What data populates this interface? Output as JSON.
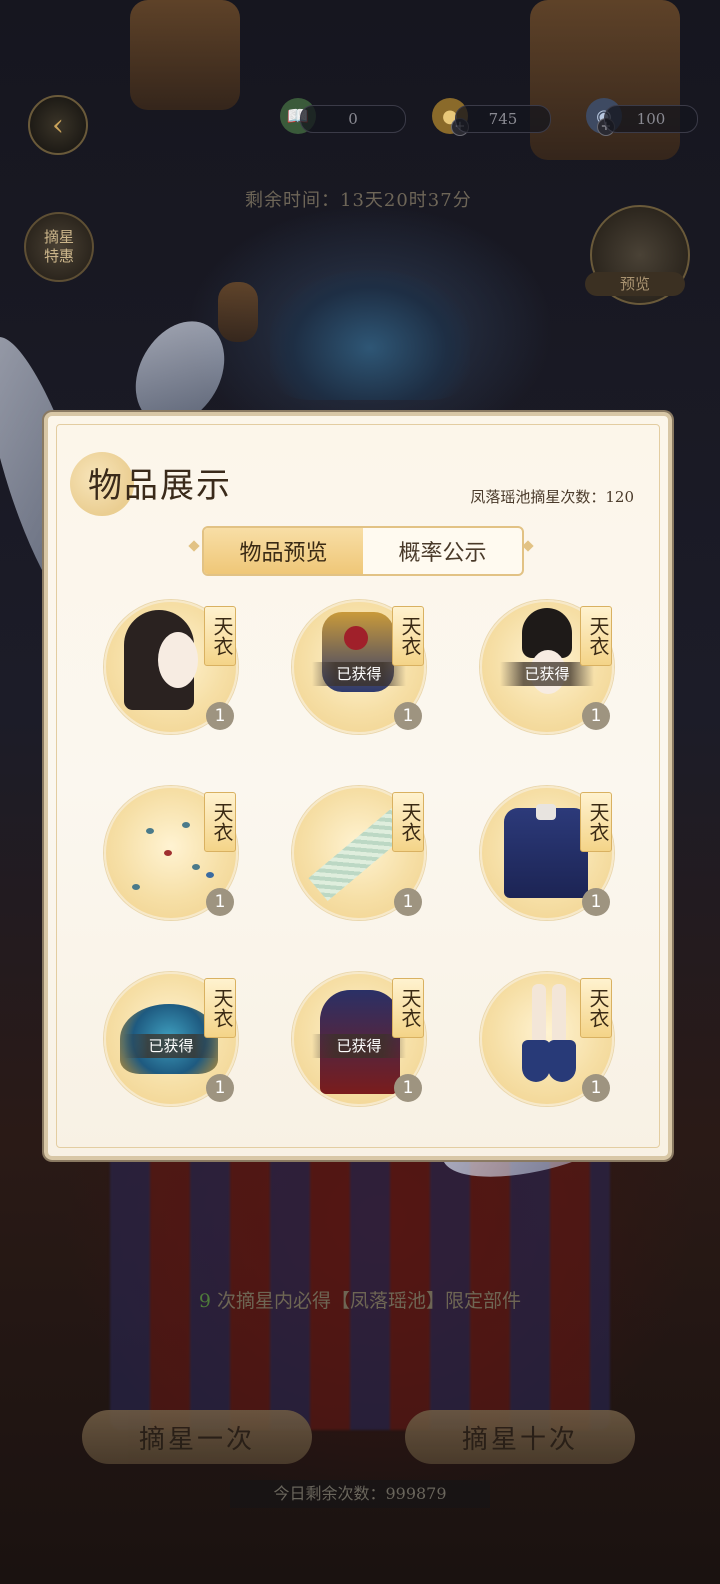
{
  "hud": {
    "currencies": [
      {
        "icon": "book-icon",
        "value": "0"
      },
      {
        "icon": "coin-icon",
        "value": "745"
      },
      {
        "icon": "orb-icon",
        "value": "100"
      }
    ],
    "timer": "剩余时间：13天20时37分",
    "side_button": "摘星\n特惠",
    "preview_button": "预览"
  },
  "panel": {
    "title": "物品展示",
    "pull_count": "凤落瑶池摘星次数：120",
    "tabs": [
      {
        "label": "物品预览",
        "active": true
      },
      {
        "label": "概率公示",
        "active": false
      }
    ],
    "items": [
      {
        "name": "hairstyle",
        "badge": "天衣",
        "qty": "1",
        "owned": ""
      },
      {
        "name": "jewel-accessory",
        "badge": "天衣",
        "qty": "1",
        "owned": "已获得"
      },
      {
        "name": "hair-crown",
        "badge": "天衣",
        "qty": "1",
        "owned": "已获得"
      },
      {
        "name": "birds-effect",
        "badge": "天衣",
        "qty": "1",
        "owned": ""
      },
      {
        "name": "jade-ribbon",
        "badge": "天衣",
        "qty": "1",
        "owned": ""
      },
      {
        "name": "blue-jacket",
        "badge": "天衣",
        "qty": "1",
        "owned": ""
      },
      {
        "name": "phoenix-crown",
        "badge": "天衣",
        "qty": "1",
        "owned": "已获得"
      },
      {
        "name": "dress",
        "badge": "天衣",
        "qty": "1",
        "owned": "已获得"
      },
      {
        "name": "shoes",
        "badge": "天衣",
        "qty": "1",
        "owned": ""
      }
    ]
  },
  "bottom": {
    "guarantee_count": "9",
    "guarantee_text": " 次摘星内必得【凤落瑶池】限定部件",
    "draw_once": "摘星一次",
    "draw_ten": "摘星十次",
    "remaining": "今日剩余次数：999879"
  }
}
